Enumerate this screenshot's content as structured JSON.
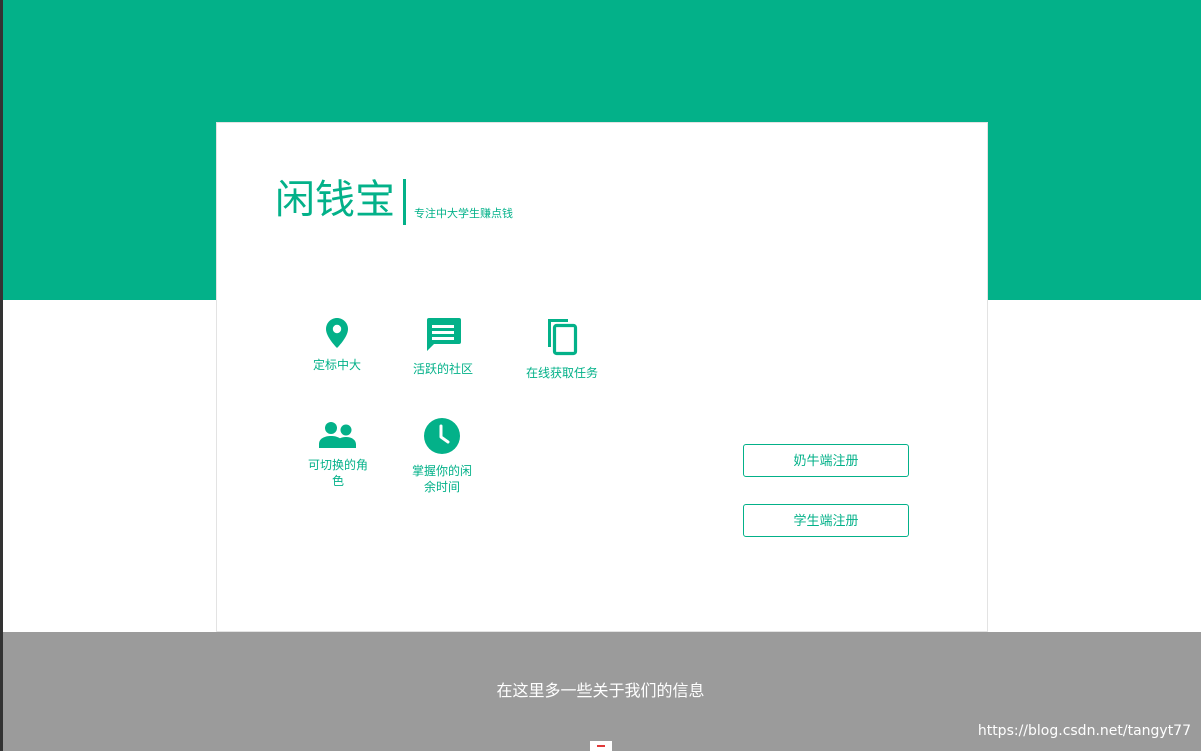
{
  "brand": {
    "name": "闲钱宝",
    "tagline": "专注中大学生赚点钱"
  },
  "features": [
    {
      "icon": "location-pin-icon",
      "label": "定标中大"
    },
    {
      "icon": "chat-bubble-icon",
      "label": "活跃的社区"
    },
    {
      "icon": "copy-documents-icon",
      "label": "在线获取任务"
    },
    {
      "icon": "users-icon",
      "label": "可切换的角色"
    },
    {
      "icon": "clock-icon",
      "label": "掌握你的闲余时间"
    }
  ],
  "buttons": {
    "cow_register": "奶牛端注册",
    "student_register": "学生端注册"
  },
  "footer": {
    "text": "在这里多一些关于我们的信息"
  },
  "watermark": "https://blog.csdn.net/tangyt77",
  "colors": {
    "accent": "#03b189",
    "footer_bg": "#9b9b9b",
    "card_bg": "#ffffff"
  }
}
